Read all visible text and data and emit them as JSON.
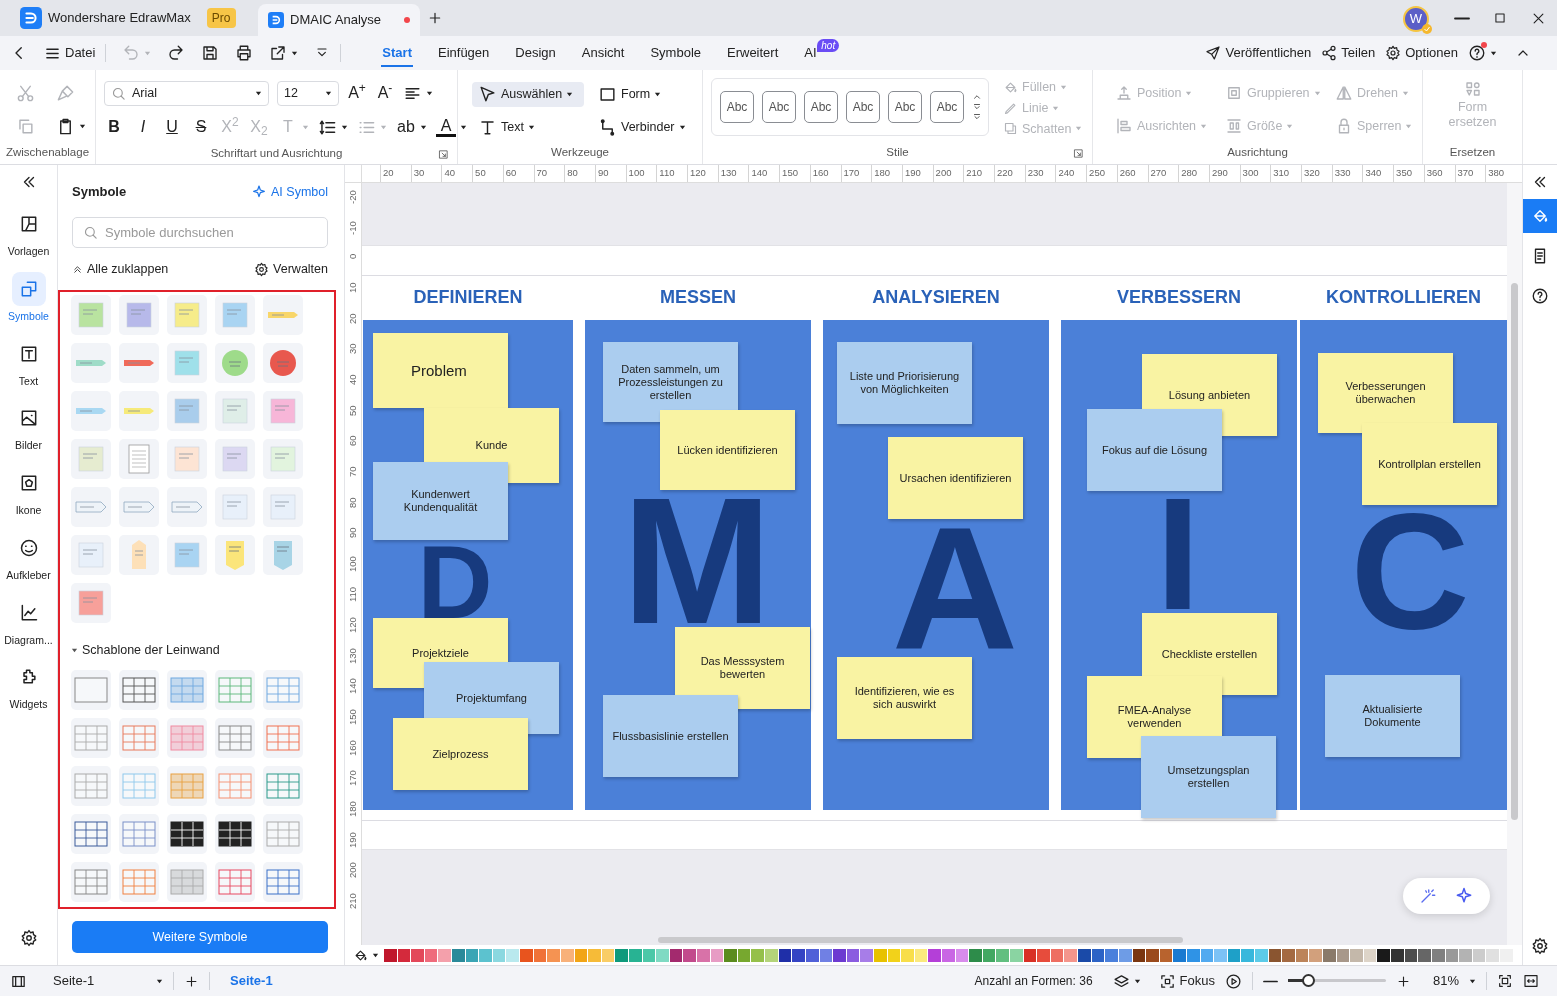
{
  "title_bar": {
    "app_tab": {
      "label": "Wondershare EdrawMax",
      "badge": "Pro"
    },
    "doc_tab": {
      "label": "DMAIC Analyse",
      "selected": true,
      "unsaved": true
    },
    "avatar": "W"
  },
  "menu_bar": {
    "file": "Datei",
    "quick_actions": [
      {
        "kind": "undo",
        "disabled": true
      },
      {
        "kind": "redo",
        "disabled": false
      },
      {
        "kind": "save",
        "disabled": false
      },
      {
        "kind": "print",
        "disabled": false
      },
      {
        "kind": "export",
        "disabled": false
      }
    ],
    "tabs": [
      {
        "label": "Start",
        "selected": true
      },
      {
        "label": "Einfügen",
        "selected": false
      },
      {
        "label": "Design",
        "selected": false
      },
      {
        "label": "Ansicht",
        "selected": false
      },
      {
        "label": "Symbole",
        "selected": false
      },
      {
        "label": "Erweitert",
        "selected": false
      },
      {
        "label": "AI",
        "selected": false,
        "badge": "hot"
      }
    ],
    "actions": [
      {
        "label": "Veröffentlichen",
        "kind": "send"
      },
      {
        "label": "Teilen",
        "kind": "share"
      },
      {
        "label": "Optionen",
        "kind": "gear"
      }
    ],
    "help_notification": true
  },
  "ribbon": {
    "clipboard": {
      "title": "Zwischenablage",
      "buttons": [
        {
          "kind": "cut",
          "disabled": true
        },
        {
          "kind": "painter",
          "disabled": true
        },
        {
          "kind": "copy",
          "disabled": true
        },
        {
          "kind": "paste",
          "disabled": false
        }
      ]
    },
    "font": {
      "title": "Schriftart und Ausrichtung",
      "font": "Arial",
      "size": "12",
      "row1": [
        {
          "kind": "glyph",
          "label": "A$^{+}$",
          "disabled": false,
          "dropdown": false
        },
        {
          "kind": "glyph",
          "label": "A$^{-}$",
          "disabled": false,
          "dropdown": false
        },
        {
          "kind": "align",
          "disabled": false,
          "dropdown": true
        }
      ],
      "row2": [
        {
          "kind": "bold",
          "label": "B",
          "disabled": false,
          "dropdown": false
        },
        {
          "kind": "italic",
          "label": "I",
          "disabled": false,
          "dropdown": false
        },
        {
          "kind": "underline",
          "label": "U",
          "disabled": false,
          "dropdown": false
        },
        {
          "kind": "strike",
          "label": "S",
          "disabled": false,
          "dropdown": false
        },
        {
          "kind": "glyph",
          "label": "X$^{2}$",
          "disabled": true,
          "dropdown": false
        },
        {
          "kind": "glyph",
          "label": "X$_{2}$",
          "disabled": true,
          "dropdown": false
        },
        {
          "kind": "glyph",
          "label": "T",
          "disabled": true,
          "dropdown": true
        },
        {
          "kind": "spacing",
          "disabled": false,
          "dropdown": true
        },
        {
          "kind": "bullets",
          "disabled": true,
          "dropdown": true
        },
        {
          "kind": "glyph",
          "label": "ab",
          "disabled": false,
          "dropdown": true
        },
        {
          "kind": "fontcolor",
          "label": "A",
          "disabled": false,
          "dropdown": true
        }
      ]
    },
    "tools": {
      "title": "Werkzeuge",
      "items": [
        {
          "label": "Auswählen",
          "kind": "pointer",
          "selected": true
        },
        {
          "label": "Form",
          "kind": "square",
          "selected": false
        },
        {
          "label": "Text",
          "kind": "textT",
          "selected": false
        },
        {
          "label": "Verbinder",
          "kind": "connector",
          "selected": false
        }
      ]
    },
    "styles": {
      "title": "Stile",
      "samples": [
        "Abc",
        "Abc",
        "Abc",
        "Abc",
        "Abc",
        "Abc"
      ],
      "props": [
        {
          "label": "Füllen",
          "kind": "bucket",
          "disabled": true
        },
        {
          "label": "Linie",
          "kind": "pen",
          "disabled": true
        },
        {
          "label": "Schatten",
          "kind": "shadow",
          "disabled": true
        }
      ]
    },
    "arrange": {
      "title": "Ausrichtung",
      "items": [
        {
          "label": "Position",
          "kind": "position",
          "disabled": true
        },
        {
          "label": "Gruppieren",
          "kind": "group",
          "disabled": true
        },
        {
          "label": "Drehen",
          "kind": "rotate",
          "disabled": true
        },
        {
          "label": "Ausrichten",
          "kind": "alignL",
          "disabled": true
        },
        {
          "label": "Größe",
          "kind": "size",
          "disabled": true
        },
        {
          "label": "Sperren",
          "kind": "lock",
          "disabled": true
        }
      ]
    },
    "replace": {
      "title": "Ersetzen",
      "label": "Form ersetzen",
      "disabled": true
    }
  },
  "left_rail": {
    "items": [
      {
        "label": "Vorlagen",
        "kind": "templates",
        "selected": false
      },
      {
        "label": "Symbole",
        "kind": "symbols",
        "selected": true
      },
      {
        "label": "Text",
        "kind": "textbox",
        "selected": false
      },
      {
        "label": "Bilder",
        "kind": "image",
        "selected": false
      },
      {
        "label": "Ikone",
        "kind": "iconsq",
        "selected": false
      },
      {
        "label": "Aufkleber",
        "kind": "sticker",
        "selected": false
      },
      {
        "label": "Diagram...",
        "kind": "chart",
        "selected": false
      },
      {
        "label": "Widgets",
        "kind": "widget",
        "selected": false
      }
    ]
  },
  "symbol_panel": {
    "title": "Symbole",
    "ai_link": "AI Symbol",
    "search_placeholder": "Symbole durchsuchen",
    "collapse_all": "Alle zuklappen",
    "manage": "Verwalten",
    "section": {
      "title": "Schablone der Leinwand",
      "expanded": true
    },
    "more_button": "Weitere Symbole"
  },
  "canvas": {
    "rulers": {
      "horizontal": [
        "20",
        "30",
        "40",
        "50",
        "60",
        "70",
        "80",
        "90",
        "100",
        "110",
        "120",
        "130",
        "140",
        "150",
        "160",
        "170",
        "180",
        "190",
        "200",
        "210",
        "220",
        "230",
        "240",
        "250",
        "260",
        "270",
        "280",
        "290",
        "300",
        "310",
        "320",
        "330",
        "340",
        "350",
        "360",
        "370",
        "380"
      ],
      "vertical": [
        "-20",
        "-10",
        "0",
        "10",
        "20",
        "30",
        "40",
        "50",
        "60",
        "70",
        "80",
        "90",
        "100",
        "110",
        "120",
        "130",
        "140",
        "150",
        "160",
        "170",
        "180",
        "190",
        "200",
        "210"
      ]
    },
    "columns": [
      {
        "heading": "DEFINIEREN",
        "letter": "D",
        "notes": [
          {
            "text": "Problem",
            "kind": "title",
            "color": "#f9f3a3"
          },
          {
            "text": "Kunde",
            "kind": "note",
            "color": "#f9f3a3"
          },
          {
            "text": "Kundenwert Kundenqualität",
            "kind": "note",
            "color": "#abcdef"
          },
          {
            "text": "Projektziele",
            "kind": "note",
            "color": "#f9f3a3"
          },
          {
            "text": "Projektumfang",
            "kind": "note",
            "color": "#abcdef"
          },
          {
            "text": "Zielprozess",
            "kind": "note",
            "color": "#f9f3a3"
          }
        ]
      },
      {
        "heading": "MESSEN",
        "letter": "M",
        "notes": [
          {
            "text": "Daten sammeln, um Prozessleistungen zu erstellen",
            "kind": "note",
            "color": "#abcdef"
          },
          {
            "text": "Lücken identifizieren",
            "kind": "note",
            "color": "#f9f3a3"
          },
          {
            "text": "Das Messsystem bewerten",
            "kind": "note",
            "color": "#f9f3a3"
          },
          {
            "text": "Flussbasislinie erstellen",
            "kind": "note",
            "color": "#abcdef"
          }
        ]
      },
      {
        "heading": "ANALYSIEREN",
        "letter": "A",
        "notes": [
          {
            "text": "Liste und Priorisierung von Möglichkeiten",
            "kind": "note",
            "color": "#abcdef"
          },
          {
            "text": "Ursachen identifizieren",
            "kind": "note",
            "color": "#f9f3a3"
          },
          {
            "text": "Identifizieren, wie es sich auswirkt",
            "kind": "note",
            "color": "#f9f3a3"
          }
        ]
      },
      {
        "heading": "VERBESSERN",
        "letter": "I",
        "notes": [
          {
            "text": "Lösung anbieten",
            "kind": "note",
            "color": "#f9f3a3"
          },
          {
            "text": "Fokus auf die Lösung",
            "kind": "note",
            "color": "#abcdef"
          },
          {
            "text": "Checkliste erstellen",
            "kind": "note",
            "color": "#f9f3a3"
          },
          {
            "text": "FMEA-Analyse verwenden",
            "kind": "note",
            "color": "#f9f3a3"
          },
          {
            "text": "Umsetzungsplan erstellen",
            "kind": "note",
            "color": "#abcdef"
          }
        ]
      },
      {
        "heading": "KONTROLLIEREN",
        "letter": "C",
        "notes": [
          {
            "text": "Verbesserungen überwachen",
            "kind": "note",
            "color": "#f9f3a3"
          },
          {
            "text": "Kontrollplan erstellen",
            "kind": "note",
            "color": "#f9f3a3"
          },
          {
            "text": "Aktualisierte Dokumente",
            "kind": "note",
            "color": "#abcdef"
          }
        ]
      }
    ]
  },
  "palette": [
    {
      "color": "#c0172c"
    },
    {
      "color": "#d42a3c"
    },
    {
      "color": "#e3485a"
    },
    {
      "color": "#ef6b7c"
    },
    {
      "color": "#f4a0ab"
    },
    {
      "color": "#2a8a9a"
    },
    {
      "color": "#3aa5b5"
    },
    {
      "color": "#5cc2cf"
    },
    {
      "color": "#8ad8e0"
    },
    {
      "color": "#b9e9ee"
    },
    {
      "color": "#e8541e"
    },
    {
      "color": "#f07238"
    },
    {
      "color": "#f59352"
    },
    {
      "color": "#f8b17a"
    },
    {
      "color": "#f2a516"
    },
    {
      "color": "#f6bb38"
    },
    {
      "color": "#f9cd66"
    },
    {
      "color": "#0e9a7c"
    },
    {
      "color": "#28b393"
    },
    {
      "color": "#4cc8a8"
    },
    {
      "color": "#7fdac3"
    },
    {
      "color": "#a32a6e"
    },
    {
      "color": "#c24a8c"
    },
    {
      "color": "#d872a8"
    },
    {
      "color": "#e79cc4"
    },
    {
      "color": "#5b8c1e"
    },
    {
      "color": "#77a82f"
    },
    {
      "color": "#95c04a"
    },
    {
      "color": "#b4d47a"
    },
    {
      "color": "#1f2fa8"
    },
    {
      "color": "#3444c4"
    },
    {
      "color": "#5060d8"
    },
    {
      "color": "#7080e4"
    },
    {
      "color": "#6c3ad1"
    },
    {
      "color": "#8a5ce0"
    },
    {
      "color": "#a77de8"
    },
    {
      "color": "#e8c200"
    },
    {
      "color": "#f2d21a"
    },
    {
      "color": "#f8de4a"
    },
    {
      "color": "#fbe97e"
    },
    {
      "color": "#b43fd8"
    },
    {
      "color": "#c966e4"
    },
    {
      "color": "#d88cec"
    },
    {
      "color": "#2d8c4a"
    },
    {
      "color": "#42a862"
    },
    {
      "color": "#62bf80"
    },
    {
      "color": "#8ad4a2"
    },
    {
      "color": "#d93025"
    },
    {
      "color": "#e74c3c"
    },
    {
      "color": "#ee6e62"
    },
    {
      "color": "#f4958c"
    },
    {
      "color": "#1a4aa8"
    },
    {
      "color": "#2c63c6"
    },
    {
      "color": "#4a80dc"
    },
    {
      "color": "#6e9ce6"
    },
    {
      "color": "#7a3610"
    },
    {
      "color": "#9a4a1c"
    },
    {
      "color": "#b8632e"
    },
    {
      "color": "#1a7ad1"
    },
    {
      "color": "#2f93e6"
    },
    {
      "color": "#52aaf0"
    },
    {
      "color": "#7cc2f6"
    },
    {
      "color": "#1ea0c8"
    },
    {
      "color": "#38b8dc"
    },
    {
      "color": "#5ccbe8"
    },
    {
      "color": "#8a5530"
    },
    {
      "color": "#a46a42"
    },
    {
      "color": "#bc845a"
    },
    {
      "color": "#d2a07c"
    },
    {
      "color": "#8a7a6a"
    },
    {
      "color": "#a8988a"
    },
    {
      "color": "#c4b8aa"
    },
    {
      "color": "#ddd4c8"
    },
    {
      "color": "#1a1a1a"
    },
    {
      "color": "#333333"
    },
    {
      "color": "#4d4d4d"
    },
    {
      "color": "#666666"
    },
    {
      "color": "#808080"
    },
    {
      "color": "#999999"
    },
    {
      "color": "#b3b3b3"
    },
    {
      "color": "#cccccc"
    },
    {
      "color": "#e0e0e0"
    },
    {
      "color": "#f0f0f0"
    }
  ],
  "status_bar": {
    "page_select": "Seite-1",
    "page_tabs": [
      {
        "label": "Seite-1",
        "selected": true
      }
    ],
    "shape_count": "Anzahl an Formen: 36",
    "focus": "Fokus",
    "zoom": {
      "level": 0.2,
      "reading": "81%"
    }
  }
}
